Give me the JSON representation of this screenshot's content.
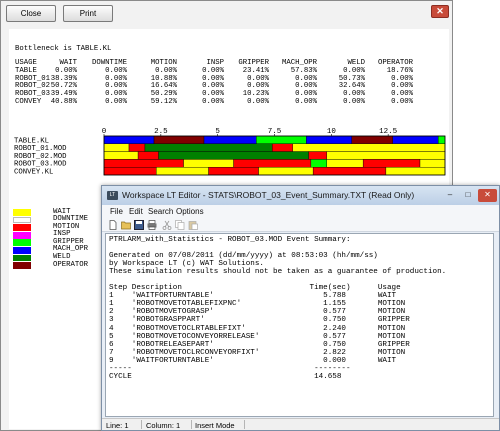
{
  "report_window": {
    "close_label": "Close",
    "print_label": "Print",
    "bottleneck_text": "Bottleneck is TABLE.KL",
    "stats_header": [
      "USAGE",
      "WAIT",
      "DOWNTIME",
      "MOTION",
      "INSP",
      "GRIPPER",
      "MACH_OPR",
      "WELD",
      "OPERATOR"
    ],
    "stats_rows": [
      [
        "TABLE",
        "0.00%",
        "0.00%",
        "0.00%",
        "0.00%",
        "23.41%",
        "57.83%",
        "0.00%",
        "18.76%"
      ],
      [
        "ROBOT_01",
        "38.39%",
        "0.00%",
        "10.88%",
        "0.00%",
        "0.00%",
        "0.00%",
        "50.73%",
        "0.00%"
      ],
      [
        "ROBOT_02",
        "50.72%",
        "0.00%",
        "16.64%",
        "0.00%",
        "0.00%",
        "0.00%",
        "32.64%",
        "0.00%"
      ],
      [
        "ROBOT_03",
        "39.49%",
        "0.00%",
        "50.29%",
        "0.00%",
        "10.23%",
        "0.00%",
        "0.00%",
        "0.00%"
      ],
      [
        "CONVEY",
        "40.88%",
        "0.00%",
        "59.12%",
        "0.00%",
        "0.00%",
        "0.00%",
        "0.00%",
        "0.00%"
      ]
    ]
  },
  "chart_data": {
    "type": "bar",
    "orientation": "horizontal-timeline",
    "xlim": [
      0,
      15
    ],
    "ticks": [
      "0",
      "2.5",
      "5",
      "7.5",
      "10",
      "12.5"
    ],
    "tick_values": [
      0,
      2.5,
      5,
      7.5,
      10,
      12.5
    ],
    "rows": [
      {
        "name": "TABLE.KL",
        "segments": [
          {
            "start": 0,
            "end": 2.2,
            "state": "MACH_OPR"
          },
          {
            "start": 2.2,
            "end": 4.4,
            "state": "OPERATOR"
          },
          {
            "start": 4.4,
            "end": 6.7,
            "state": "MACH_OPR"
          },
          {
            "start": 6.7,
            "end": 8.9,
            "state": "GRIPPER"
          },
          {
            "start": 8.9,
            "end": 10.9,
            "state": "MACH_OPR"
          },
          {
            "start": 10.9,
            "end": 12.7,
            "state": "OPERATOR"
          },
          {
            "start": 12.7,
            "end": 14.7,
            "state": "MACH_OPR"
          },
          {
            "start": 14.7,
            "end": 15,
            "state": "GRIPPER"
          }
        ]
      },
      {
        "name": "ROBOT_01.MOD",
        "segments": [
          {
            "start": 0,
            "end": 1.1,
            "state": "WAIT"
          },
          {
            "start": 1.1,
            "end": 1.8,
            "state": "MOTION"
          },
          {
            "start": 1.8,
            "end": 7.4,
            "state": "WELD"
          },
          {
            "start": 7.4,
            "end": 8.3,
            "state": "MOTION"
          },
          {
            "start": 8.3,
            "end": 15,
            "state": "WAIT"
          }
        ]
      },
      {
        "name": "ROBOT_02.MOD",
        "segments": [
          {
            "start": 0,
            "end": 1.5,
            "state": "WAIT"
          },
          {
            "start": 1.5,
            "end": 2.4,
            "state": "MOTION"
          },
          {
            "start": 2.4,
            "end": 9.0,
            "state": "WELD"
          },
          {
            "start": 9.0,
            "end": 9.8,
            "state": "MOTION"
          },
          {
            "start": 9.8,
            "end": 15,
            "state": "WAIT"
          }
        ]
      },
      {
        "name": "ROBOT_03.MOD",
        "segments": [
          {
            "start": 0,
            "end": 3.5,
            "state": "MOTION"
          },
          {
            "start": 3.5,
            "end": 5.7,
            "state": "WAIT"
          },
          {
            "start": 5.7,
            "end": 9.1,
            "state": "MOTION"
          },
          {
            "start": 9.1,
            "end": 9.8,
            "state": "GRIPPER"
          },
          {
            "start": 9.8,
            "end": 11.4,
            "state": "WAIT"
          },
          {
            "start": 11.4,
            "end": 13.9,
            "state": "MOTION"
          },
          {
            "start": 13.9,
            "end": 15,
            "state": "WAIT"
          }
        ]
      },
      {
        "name": "CONVEY.KL",
        "segments": [
          {
            "start": 0,
            "end": 2.3,
            "state": "MOTION"
          },
          {
            "start": 2.3,
            "end": 4.6,
            "state": "WAIT"
          },
          {
            "start": 4.6,
            "end": 6.8,
            "state": "MOTION"
          },
          {
            "start": 6.8,
            "end": 9.2,
            "state": "WAIT"
          },
          {
            "start": 9.2,
            "end": 12.4,
            "state": "MOTION"
          },
          {
            "start": 12.4,
            "end": 15,
            "state": "WAIT"
          }
        ]
      }
    ],
    "legend": [
      {
        "label": "WAIT",
        "color": "#ffff00"
      },
      {
        "label": "DOWNTIME",
        "color": "#ffffff"
      },
      {
        "label": "MOTION",
        "color": "#ff0000"
      },
      {
        "label": "INSP",
        "color": "#ff00ff"
      },
      {
        "label": "GRIPPER",
        "color": "#00ff00"
      },
      {
        "label": "MACH_OPR",
        "color": "#0000ff"
      },
      {
        "label": "WELD",
        "color": "#008000"
      },
      {
        "label": "OPERATOR",
        "color": "#800000"
      }
    ]
  },
  "editor_window": {
    "title": "Workspace LT Editor - STATS\\ROBOT_03_Event_Summary.TXT (Read Only)",
    "menu": [
      "File",
      "Edit",
      "Search",
      "Options"
    ],
    "content_lines": [
      "PTRLARM_with_Statistics - ROBOT_03.MOD Event Summary:",
      "",
      "Generated on 07/08/2011 (dd/mm/yyyy) at 08:53:03 (hh/mm/ss)",
      "by Workspace LT (c) WAT Solutions.",
      "These simulation results should not be taken as a guarantee of production.",
      "",
      "Step Description                            Time(sec)      Usage",
      "1    'WAITFORTURNTABLE'                        5.788       WAIT",
      "1    'ROBOTMOVETOTABLEFIXPNC'                  1.155       MOTION",
      "2    'ROBOTMOVETOGRASP'                        0.577       MOTION",
      "3    'ROBOTGRASPPART'                          0.750       GRIPPER",
      "4    'ROBOTMOVETOCLRTABLEFIXT'                 2.240       MOTION",
      "5    'ROBOTMOVETOCONVEYORRELEASE'              0.577       MOTION",
      "6    'ROBOTRELEASEPART'                        0.750       GRIPPER",
      "7    'ROBOTMOVETOCLRCONVEYORFIXT'              2.822       MOTION",
      "9    'WAITFORTURNTABLE'                        0.000       WAIT",
      "-----                                        --------",
      "CYCLE                                        14.658"
    ],
    "status": {
      "line": "Line: 1",
      "column": "Column: 1",
      "mode": "Insert Mode"
    }
  }
}
